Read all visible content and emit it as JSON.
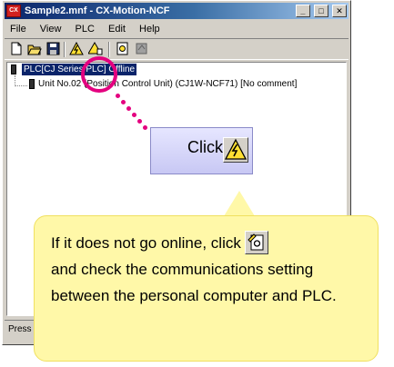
{
  "window": {
    "title": "Sample2.mnf - CX-Motion-NCF",
    "min_glyph": "_",
    "max_glyph": "□",
    "close_glyph": "✕"
  },
  "menu": [
    "File",
    "View",
    "PLC",
    "Edit",
    "Help"
  ],
  "toolbar": {
    "icons": [
      "new-file-icon",
      "open-folder-icon",
      "save-disk-icon",
      "work-online-icon",
      "go-offline-icon",
      "settings-icon",
      "transfer-icon"
    ]
  },
  "tree": {
    "root_label": "PLC[CJ Series PLC] Offline",
    "child_label": "Unit No.02 (Position Control Unit) (CJ1W-NCF71) [No comment]"
  },
  "status": {
    "text": "Press"
  },
  "callout_click": {
    "label": "Click"
  },
  "callout_note": {
    "text_before_icon": "If it does not go online, click",
    "text_after_icon": "and check the communications setting between the personal computer and PLC."
  },
  "colors": {
    "highlight": "#e4007f",
    "note_background": "#fff8a8",
    "click_callout_background": "#d8d8fa",
    "online_icon_fill": "#ffe033",
    "titlebar": "#0a246a"
  }
}
